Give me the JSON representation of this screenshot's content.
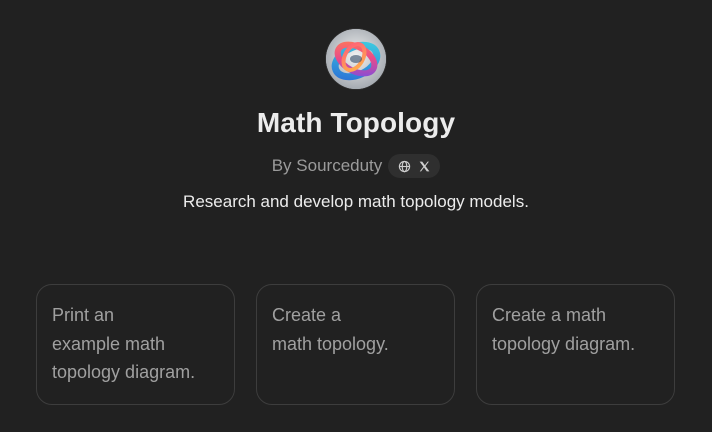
{
  "gpt": {
    "name": "Math Topology",
    "author": "By Sourceduty",
    "description": "Research and develop math topology models.",
    "avatar_icon": "abstract-knot-logo",
    "social_icons": [
      "globe-icon",
      "x-icon"
    ]
  },
  "starters": [
    {
      "lines": [
        "Print an",
        "example math",
        "topology diagram."
      ]
    },
    {
      "lines": [
        "Create a",
        "math topology."
      ]
    },
    {
      "lines": [
        "Create a math",
        "topology diagram."
      ]
    }
  ],
  "colors": {
    "background": "#212121",
    "title": "#ececec",
    "muted": "#9b9b9b",
    "card_border": "#3d3d3d",
    "card_text": "#a0a0a0"
  }
}
